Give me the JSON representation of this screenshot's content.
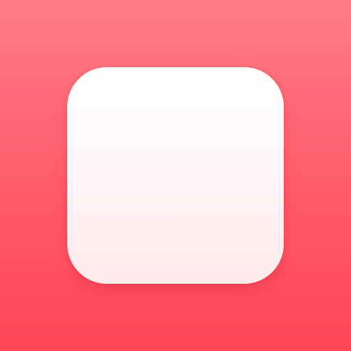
{
  "icon": {
    "background_top_color": "#ff7d86",
    "background_bottom_color": "#ff4657",
    "tile_color": "#ffffff",
    "tile_bottom_color": "#ffe9ec",
    "shape": "rounded-square-icon"
  }
}
